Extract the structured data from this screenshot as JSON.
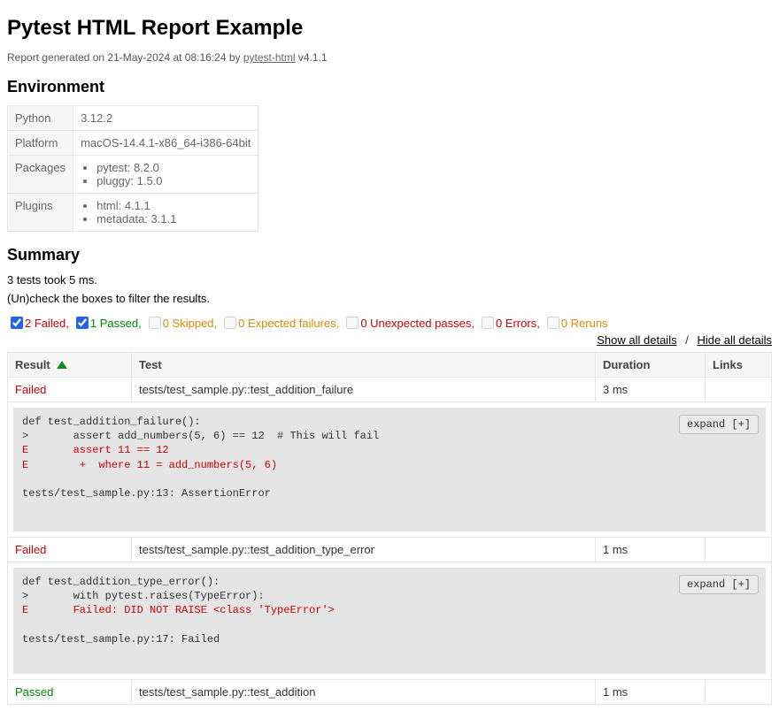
{
  "title": "Pytest HTML Report Example",
  "generated_prefix": "Report generated on ",
  "generated_date": "21-May-2024 at 08:16:24",
  "generated_by": " by ",
  "tool_name": "pytest-html",
  "tool_version": " v4.1.1",
  "env_heading": "Environment",
  "env": {
    "python_key": "Python",
    "python_val": "3.12.2",
    "platform_key": "Platform",
    "platform_val": "macOS-14.4.1-x86_64-i386-64bit",
    "packages_key": "Packages",
    "packages": [
      "pytest: 8.2.0",
      "pluggy: 1.5.0"
    ],
    "plugins_key": "Plugins",
    "plugins": [
      "html: 4.1.1",
      "metadata: 3.1.1"
    ]
  },
  "summary_heading": "Summary",
  "summary_line": "3 tests took 5 ms.",
  "filter_hint": "(Un)check the boxes to filter the results.",
  "filters": {
    "failed": "2 Failed,",
    "passed": "1 Passed,",
    "skipped": "0 Skipped,",
    "xfail": "0 Expected failures,",
    "xpass": "0 Unexpected passes,",
    "errors": "0 Errors,",
    "reruns": "0 Reruns"
  },
  "show_all": "Show all details",
  "hide_all": "Hide all details",
  "cols": {
    "result": "Result",
    "test": "Test",
    "duration": "Duration",
    "links": "Links"
  },
  "expand_btn": "expand [+]",
  "rows": [
    {
      "status": "Failed",
      "status_class": "failed",
      "test": "tests/test_sample.py::test_addition_failure",
      "duration": "3 ms",
      "log_plain1": "def test_addition_failure():\n>       assert add_numbers(5, 6) == 12  # This will fail",
      "log_err": "E       assert 11 == 12\nE        +  where 11 = add_numbers(5, 6)",
      "log_plain2": "tests/test_sample.py:13: AssertionError"
    },
    {
      "status": "Failed",
      "status_class": "failed",
      "test": "tests/test_sample.py::test_addition_type_error",
      "duration": "1 ms",
      "log_plain1": "def test_addition_type_error():\n>       with pytest.raises(TypeError):",
      "log_err": "E       Failed: DID NOT RAISE <class 'TypeError'>",
      "log_plain2": "tests/test_sample.py:17: Failed"
    },
    {
      "status": "Passed",
      "status_class": "passed",
      "test": "tests/test_sample.py::test_addition",
      "duration": "1 ms"
    }
  ]
}
